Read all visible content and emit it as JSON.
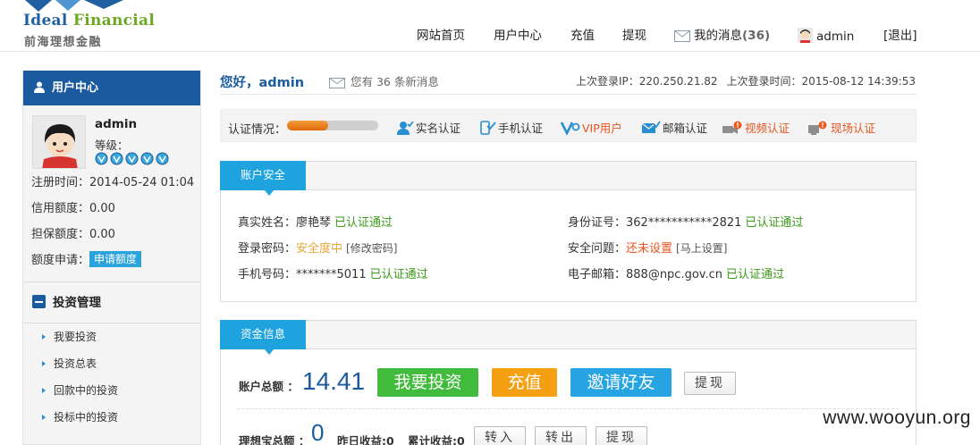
{
  "brand": {
    "name_en_a": "Ideal ",
    "name_en_b": "Financial",
    "name_cn": "前海理想金融"
  },
  "nav": {
    "home": "网站首页",
    "user_center": "用户中心",
    "recharge": "充值",
    "withdraw": "提现",
    "messages_label": "我的消息",
    "messages_count": "(36)",
    "username": "admin",
    "logout": "[退出]"
  },
  "sidebar": {
    "title": "用户中心",
    "profile": {
      "name": "admin",
      "level_label": "等级：",
      "level_badges": 5
    },
    "register_time": "注册时间：2014-05-24 01:04",
    "credit_limit": "信用额度：0.00",
    "guarantee_limit": "担保额度：0.00",
    "limit_apply_label": "额度申请：",
    "limit_apply_button": "申请额度",
    "invest_section": "投资管理",
    "invest_items": [
      "我要投资",
      "投资总表",
      "回款中的投资",
      "投标中的投资"
    ]
  },
  "greeting": "您好，admin",
  "message_note": "您有 36 条新消息",
  "last_login_ip": "上次登录IP：220.250.21.82",
  "last_login_time": "上次登录时间：2015-08-12 14:39:53",
  "auth": {
    "label": "认证情况：",
    "progress": 0.45,
    "items": {
      "realname": "实名认证",
      "phone": "手机认证",
      "vip": "VIP用户",
      "email": "邮箱认证",
      "video": "视频认证",
      "onsite": "现场认证"
    }
  },
  "security": {
    "tab": "账户安全",
    "real_name": "真实姓名：廖艳琴",
    "real_name_status": "已认证通过",
    "password_label": "登录密码：",
    "password_status": "安全度中",
    "password_link": "[修改密码]",
    "phone": "手机号码：*******5011",
    "phone_status": "已认证通过",
    "id_card": "身份证号：362***********2821",
    "id_card_status": "已认证通过",
    "question_label": "安全问题：",
    "question_status": "还未设置",
    "question_link": "[马上设置]",
    "email": "电子邮箱：888@npc.gov.cn",
    "email_status": "已认证通过"
  },
  "funds": {
    "tab": "资金信息",
    "total_label": "账户总额 ：",
    "total_value": "14.41",
    "btn_invest": "我要投资",
    "btn_recharge": "充值",
    "btn_invite": "邀请好友",
    "btn_withdraw": "提现",
    "bao_label": "理想宝总额 ：",
    "bao_value": "0",
    "yesterday_label": "昨日收益:0",
    "cumulative_label": "累计收益:0",
    "btn_in": "转入",
    "btn_out": "转出",
    "btn_withdraw2": "提现"
  },
  "watermark": "www.wooyun.org",
  "colors": {
    "brand_blue": "#1a5a9e",
    "tab_blue": "#1fa3df",
    "ok_green": "#3a9a19",
    "warn_orange": "#e8551d"
  }
}
